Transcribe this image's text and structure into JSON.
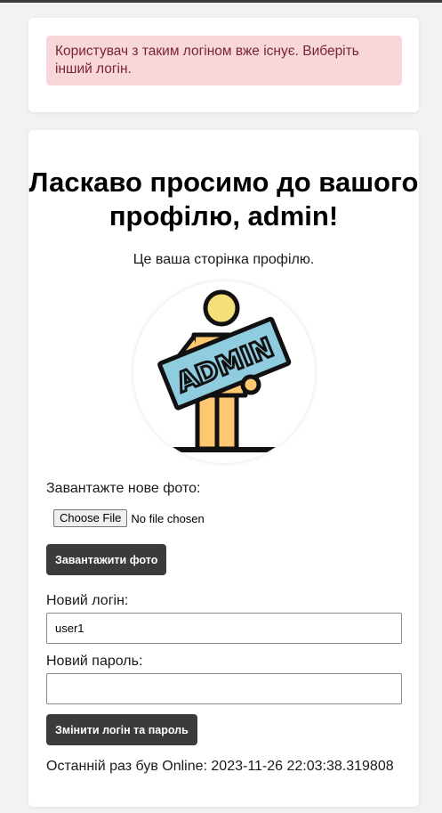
{
  "alert": {
    "message": "Користувач з таким логіном вже існує. Виберіть інший логін."
  },
  "profile": {
    "welcome_title": "Ласкаво просимо до вашого профілю, admin!",
    "subtitle": "Це ваша сторінка профілю.",
    "avatar_text": "ADMIN",
    "upload": {
      "label": "Завантажте нове фото:",
      "choose_file_label": "Choose File",
      "file_status": "No file chosen",
      "upload_button_label": "Завантажити фото"
    },
    "new_login": {
      "label": "Новий логін:",
      "value": "user1"
    },
    "new_password": {
      "label": "Новий пароль:",
      "value": ""
    },
    "change_button_label": "Змінити логін та пароль",
    "last_online": "Останній раз був Online: 2023-11-26 22:03:38.319808"
  }
}
